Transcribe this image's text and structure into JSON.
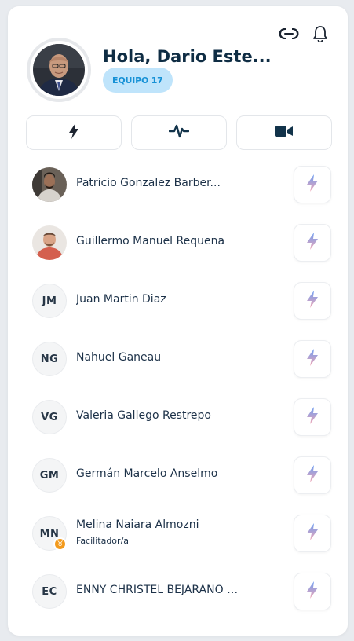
{
  "header": {
    "greeting": "Hola, Dario Este...",
    "team_badge": "EQUIPO 17"
  },
  "icons": {
    "link": "link-icon",
    "notifications": "bell-icon",
    "energy": "bolt-icon",
    "activity": "pulse-icon",
    "video": "video-camera-icon"
  },
  "colors": {
    "navy": "#0f2d44",
    "badge_bg": "#bfe4fb",
    "badge_text": "#1691d6",
    "facilitator": "#f39a1c"
  },
  "members": [
    {
      "initials": "",
      "name": "Patricio Gonzalez Barber...",
      "role": "",
      "photo": true
    },
    {
      "initials": "",
      "name": "Guillermo Manuel Requena",
      "role": "",
      "photo": true
    },
    {
      "initials": "JM",
      "name": "Juan Martin Diaz",
      "role": ""
    },
    {
      "initials": "NG",
      "name": "Nahuel Ganeau",
      "role": ""
    },
    {
      "initials": "VG",
      "name": "Valeria Gallego Restrepo",
      "role": ""
    },
    {
      "initials": "GM",
      "name": "Germán Marcelo Anselmo",
      "role": ""
    },
    {
      "initials": "MN",
      "name": "Melina Naiara Almozni",
      "role": "Facilitador/a"
    },
    {
      "initials": "EC",
      "name": "ENNY CHRISTEL BEJARANO Z...",
      "role": ""
    }
  ]
}
